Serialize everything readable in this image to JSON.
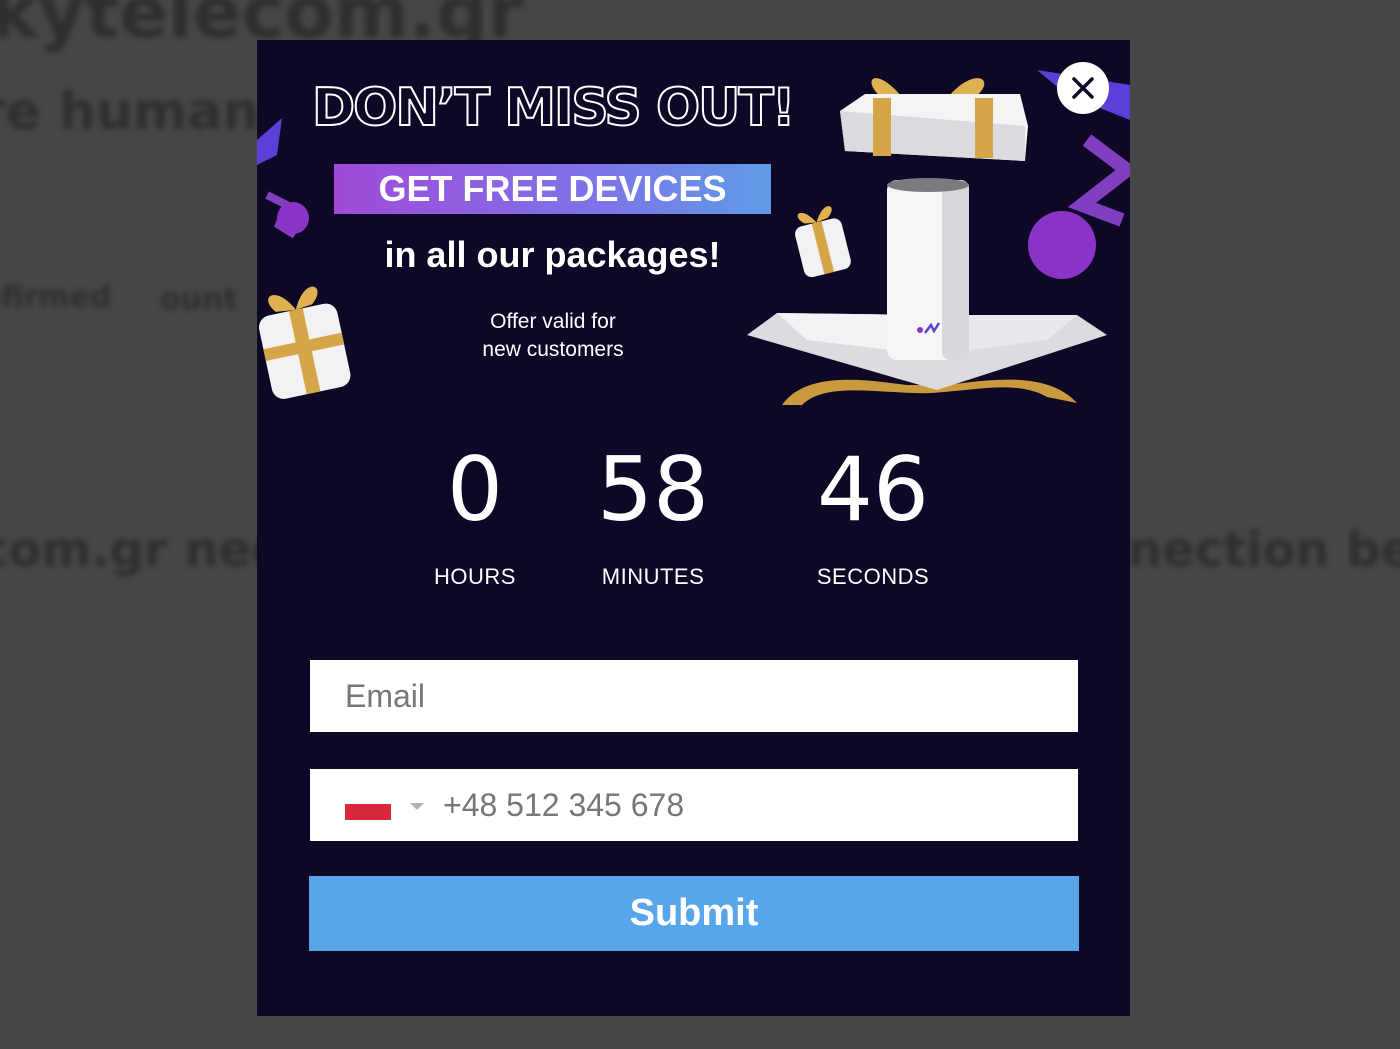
{
  "background": {
    "text_lines": [
      "kytelecom.gr",
      "re human b",
      "nfirmed",
      "ount",
      "com.gr nee",
      "nection bef"
    ]
  },
  "popup": {
    "headline": "DON’T MISS OUT!",
    "banner": "GET FREE DEVICES",
    "subheadline": "in all our packages!",
    "offer_lines": [
      "Offer valid for",
      "new customers"
    ],
    "countdown": {
      "hours": "0",
      "minutes": "58",
      "seconds": "46",
      "hours_label": "HOURS",
      "minutes_label": "MINUTES",
      "seconds_label": "SECONDS"
    },
    "form": {
      "email_placeholder": "Email",
      "phone_placeholder": "+48 512 345 678",
      "submit_label": "Submit"
    }
  },
  "icons": {
    "close": "close-icon",
    "caret": "chevron-down-icon",
    "flag": "poland-flag-icon",
    "gift": "gift-icon",
    "router": "router-device-image"
  },
  "colors": {
    "modal_bg": "#0e0725",
    "submit_bg": "#57a5ea",
    "banner_gradient_start": "#a04ad9",
    "banner_gradient_end": "#5f9be6",
    "accent_purple": "#8a33c7"
  }
}
